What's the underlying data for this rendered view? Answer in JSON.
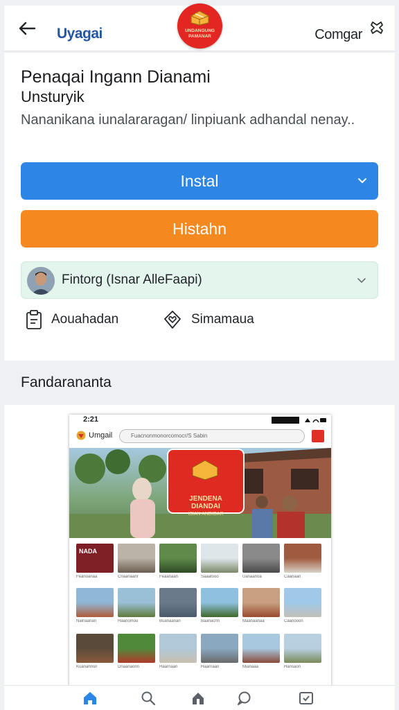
{
  "header": {
    "brand": "Uyagai",
    "compare_label": "Comgar",
    "logo_text_line1": "UNDANGUNG",
    "logo_text_line2": "PAMANAR"
  },
  "app": {
    "title": "Penaqai Ingann Dianami",
    "subtitle": "Unsturyik",
    "description": "Nananikana iunalararagan/ linpiuank adhandal nenay..",
    "install_label": "Instal",
    "secondary_label": "Histahn",
    "author_label": "Fintorg (Isnar AlleFaapi)"
  },
  "actions": [
    {
      "label": "Aouahadan",
      "icon": "clipboard-icon"
    },
    {
      "label": "Simamaua",
      "icon": "heart-shield-icon"
    }
  ],
  "section": {
    "screenshots_title": "Fandarananta"
  },
  "screenshot_preview": {
    "time": "2:21",
    "brand": "Umgail",
    "search_placeholder": "Fuacnonmonorcomocr/S Sabin",
    "hero_line1": "JENDENA",
    "hero_line2": "DIANDAI",
    "hero_line3": "ISIAN ANDIDAR",
    "tile_badge": "NADA",
    "tile_captions": [
      "Feanoanaa",
      "Cnaanaanr",
      "Feaanaan",
      "Saaatooo",
      "Uanaanoa",
      "Caanaan",
      "Nalnaanan",
      "Haanomou",
      "Buanaanan",
      "Baanacnn",
      "Maanaanaa",
      "Caanooon",
      "Kuanahnsn",
      "Dnaanaonn",
      "Haarnaan",
      "Haarnaan",
      "Mianaaa",
      "Hansaon"
    ]
  },
  "bottom_nav": [
    {
      "name": "home-icon",
      "active": true
    },
    {
      "name": "search-icon",
      "active": false
    },
    {
      "name": "apps-icon",
      "active": false
    },
    {
      "name": "chat-icon",
      "active": false
    },
    {
      "name": "library-icon",
      "active": false
    }
  ],
  "colors": {
    "install_blue": "#2d86e6",
    "secondary_orange": "#f5891f",
    "brand_red": "#e32621",
    "brand_text_blue": "#2456a4"
  }
}
